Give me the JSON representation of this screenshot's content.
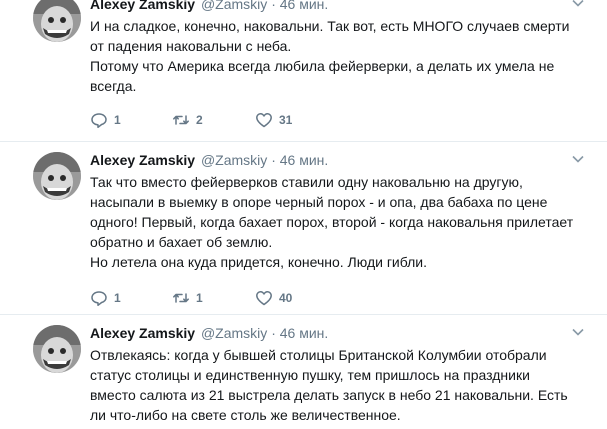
{
  "tweets": [
    {
      "name": "Alexey Zamskiy",
      "handle": "@Zamskiy",
      "dot": "·",
      "time": "46 мин.",
      "paragraphs": [
        "И на сладкое, конечно, наковальни. Так вот, есть МНОГО случаев смерти от падения наковальни с неба.",
        "Потому что Америка всегда любила фейерверки, а делать их умела не всегда."
      ],
      "replies": "1",
      "retweets": "2",
      "likes": "31"
    },
    {
      "name": "Alexey Zamskiy",
      "handle": "@Zamskiy",
      "dot": "·",
      "time": "46 мин.",
      "paragraphs": [
        "Так что вместо фейерверков ставили одну наковальню на другую, насыпали в выемку в опоре черный порох - и опа, два бабаха по цене одного! Первый, когда бахает порох, второй - когда наковальня прилетает обратно и бахает об землю.",
        "Но летела она куда придется, конечно. Люди гибли."
      ],
      "replies": "1",
      "retweets": "1",
      "likes": "40"
    },
    {
      "name": "Alexey Zamskiy",
      "handle": "@Zamskiy",
      "dot": "·",
      "time": "46 мин.",
      "paragraphs": [
        "Отвлекаясь: когда у бывшей столицы Британской Колумбии отобрали статус столицы и единственную пушку, тем пришлось на праздники вместо салюта из 21 выстрела делать запуск в небо 21 наковальни. Есть ли что-либо на свете столь же величественное."
      ]
    }
  ],
  "icons": {
    "reply": "reply-icon",
    "retweet": "retweet-icon",
    "like": "heart-icon",
    "more": "chevron-down-icon"
  },
  "colors": {
    "text": "#14171a",
    "secondary": "#657786",
    "separator": "#e6ecf0"
  }
}
